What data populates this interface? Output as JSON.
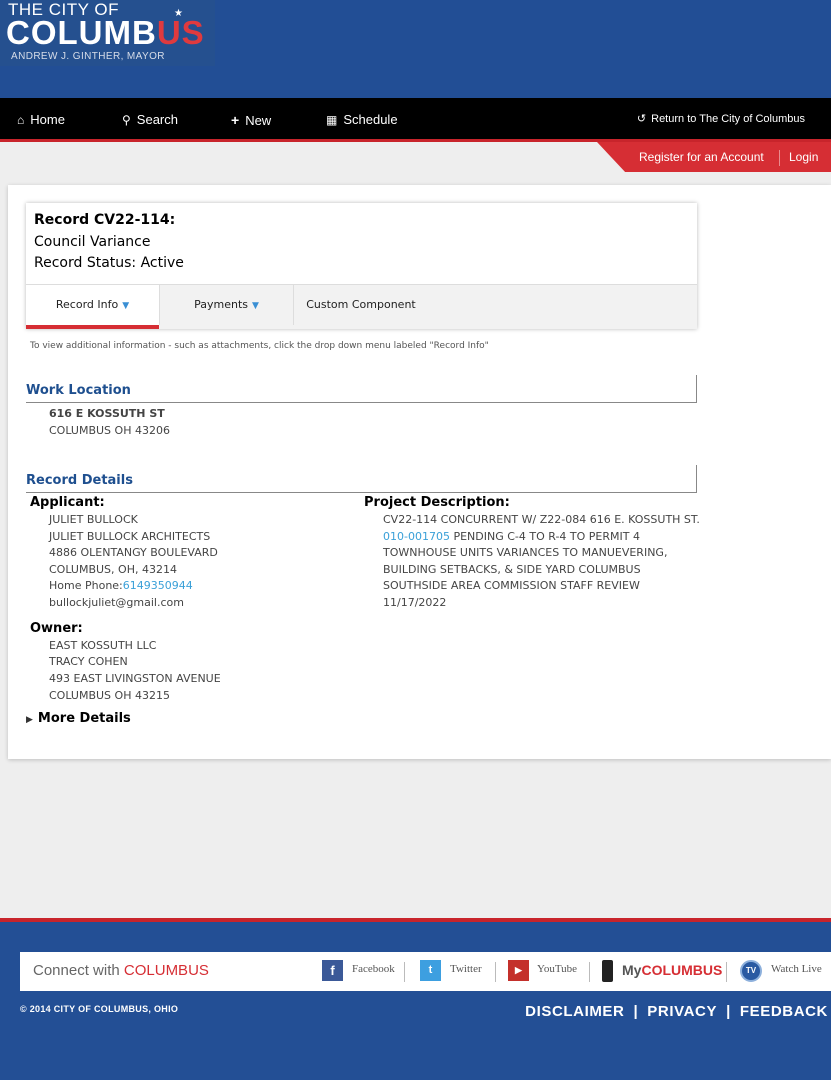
{
  "brand": {
    "top": "THE CITY OF",
    "main_a": "COLUMB",
    "main_b": "US",
    "sub": "ANDREW J. GINTHER, MAYOR"
  },
  "nav": {
    "home": "Home",
    "search": "Search",
    "new": "New",
    "schedule": "Schedule",
    "return": "Return to The City of Columbus"
  },
  "account": {
    "register": "Register for an Account",
    "login": "Login"
  },
  "record": {
    "title": "Record CV22-114:",
    "type": "Council Variance",
    "status": "Record Status: Active"
  },
  "tabs": {
    "record_info": "Record Info",
    "payments": "Payments",
    "custom": "Custom Component"
  },
  "hint": "To view additional information - such as attachments, click the drop down menu labeled \"Record Info\"",
  "work_location": {
    "title": "Work Location",
    "line1": "616 E KOSSUTH ST",
    "line2": "COLUMBUS OH 43206"
  },
  "details": {
    "title": "Record Details",
    "applicant_label": "Applicant:",
    "applicant": {
      "name": "JULIET BULLOCK",
      "company": "JULIET BULLOCK ARCHITECTS",
      "address": "4886 OLENTANGY BOULEVARD",
      "city": "COLUMBUS, OH, 43214",
      "phone_label": "Home Phone:",
      "phone": "6149350944",
      "email": "bullockjuliet@gmail.com"
    },
    "owner_label": "Owner:",
    "owner": {
      "line1": "EAST KOSSUTH LLC",
      "line2": "TRACY COHEN",
      "line3": "493 EAST LIVINGSTON AVENUE",
      "line4": "COLUMBUS OH 43215"
    },
    "project_label": "Project Description:",
    "project": {
      "line1": "CV22-114 CONCURRENT W/ Z22-084 616 E. KOSSUTH ST.",
      "link": "010-001705",
      "line2_rest": " PENDING C-4 TO R-4 TO PERMIT 4",
      "line3": "TOWNHOUSE UNITS VARIANCES TO MANUEVERING,",
      "line4": "BUILDING SETBACKS, & SIDE YARD COLUMBUS",
      "line5": "SOUTHSIDE AREA COMMISSION STAFF REVIEW",
      "line6": "11/17/2022"
    },
    "more": "More Details"
  },
  "footer": {
    "connect_a": "Connect with ",
    "connect_b": "COLUMBUS",
    "facebook": "Facebook",
    "twitter": "Twitter",
    "youtube": "YouTube",
    "mycol_a": "My",
    "mycol_b": "COLUMBUS",
    "watch": "Watch Live",
    "copyright": "© 2014 CITY OF COLUMBUS, OHIO",
    "disclaimer": "DISCLAIMER",
    "privacy": "PRIVACY",
    "feedback": "FEEDBACK",
    "sep": "|"
  },
  "colors": {
    "brand_blue": "#224e95",
    "brand_red": "#d62e34",
    "link": "#3aa0d8"
  }
}
